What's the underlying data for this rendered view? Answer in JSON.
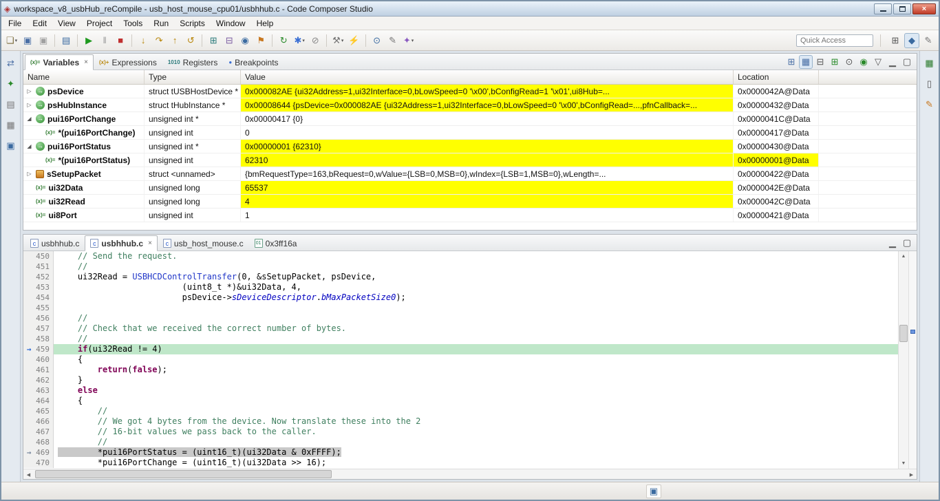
{
  "window": {
    "title": "workspace_v8_usbHub_reCompile - usb_host_mouse_cpu01/usbhhub.c - Code Composer Studio",
    "close_glyph": "×"
  },
  "menubar": {
    "items": [
      "File",
      "Edit",
      "View",
      "Project",
      "Tools",
      "Run",
      "Scripts",
      "Window",
      "Help"
    ]
  },
  "ui": {
    "close": "×",
    "dropdown": "▾",
    "collapsed": "▷",
    "expanded": "◢",
    "var_glyph": "(x)=",
    "ptr_glyph": "→",
    "marker": "→",
    "up": "▲",
    "down": "▼",
    "left": "◀",
    "right": "▶"
  },
  "toolbar": {
    "quick_access": "Quick Access",
    "buttons": [
      {
        "name": "new-file-button",
        "g": "❏",
        "c": "#7a6a3a",
        "dd": true
      },
      {
        "name": "save-button",
        "g": "▣",
        "c": "#4a6fa5"
      },
      {
        "name": "save-all-button",
        "g": "▣",
        "c": "#a0a0a0"
      },
      {
        "sep": true
      },
      {
        "name": "console-button",
        "g": "▤",
        "c": "#3a6aa0"
      },
      {
        "sep": true
      },
      {
        "name": "resume-button",
        "g": "▶",
        "c": "#1f9a1f"
      },
      {
        "name": "suspend-button",
        "g": "‖",
        "c": "#999999"
      },
      {
        "name": "terminate-button",
        "g": "■",
        "c": "#c03030"
      },
      {
        "sep": true
      },
      {
        "name": "step-into-button",
        "g": "↓",
        "c": "#b8860b"
      },
      {
        "name": "step-over-button",
        "g": "↷",
        "c": "#b8860b"
      },
      {
        "name": "step-return-button",
        "g": "↑",
        "c": "#b8860b"
      },
      {
        "name": "reset-cpu-button",
        "g": "↺",
        "c": "#b8860b"
      },
      {
        "sep": true
      },
      {
        "name": "view-registers-button",
        "g": "⊞",
        "c": "#2a7a7a"
      },
      {
        "name": "memory-browser-button",
        "g": "⊟",
        "c": "#7a5aa0"
      },
      {
        "name": "watch-button",
        "g": "◉",
        "c": "#3a6aa0"
      },
      {
        "name": "target-flag-button",
        "g": "⚑",
        "c": "#c87820"
      },
      {
        "sep": true
      },
      {
        "name": "refresh-button",
        "g": "↻",
        "c": "#2a8a2a"
      },
      {
        "name": "breakpoint-button",
        "g": "✱",
        "c": "#3b6fd4",
        "dd": true
      },
      {
        "name": "skip-breakpoints-button",
        "g": "⊘",
        "c": "#888888"
      },
      {
        "sep": true
      },
      {
        "name": "build-button",
        "g": "⚒",
        "c": "#777777",
        "dd": true
      },
      {
        "name": "flash-button",
        "g": "⚡",
        "c": "#c8a000"
      },
      {
        "sep": true
      },
      {
        "name": "search-button",
        "g": "⊙",
        "c": "#3a6aa0"
      },
      {
        "name": "annotate-button",
        "g": "✎",
        "c": "#777777"
      },
      {
        "name": "wand-button",
        "g": "✦",
        "c": "#8a5ac0",
        "dd": true
      }
    ],
    "perspectives": [
      {
        "name": "open-perspective-button",
        "g": "⊞",
        "c": "#555555"
      },
      {
        "name": "ccs-debug-perspective-button",
        "g": "◆",
        "c": "#3a6aa0",
        "pressed": true
      },
      {
        "name": "ccs-edit-perspective-button",
        "g": "✎",
        "c": "#777777"
      }
    ]
  },
  "left_strip": [
    {
      "name": "minimized-view-button-1",
      "g": "⇄",
      "c": "#4a6fa5"
    },
    {
      "name": "minimized-view-button-2",
      "g": "✦",
      "c": "#2a8a2a"
    },
    {
      "name": "minimized-view-button-3",
      "g": "▤",
      "c": "#777777"
    },
    {
      "name": "minimized-view-button-4",
      "g": "▦",
      "c": "#777777"
    },
    {
      "name": "console-view-button",
      "g": "▣",
      "c": "#3a6aa0"
    }
  ],
  "right_strip": [
    {
      "name": "side-grid-button",
      "g": "▦",
      "c": "#2a7a2a"
    },
    {
      "name": "side-device-button",
      "g": "▯",
      "c": "#555555"
    },
    {
      "name": "side-edit-button",
      "g": "✎",
      "c": "#c87820"
    }
  ],
  "variables_view": {
    "tabs": [
      {
        "label": "Variables",
        "icon": "(x)=",
        "icon_color": "#2f7a2f",
        "active": true
      },
      {
        "label": "Expressions",
        "icon": "(x)+",
        "icon_color": "#b8860b"
      },
      {
        "label": "Registers",
        "icon": "1010",
        "icon_color": "#2a7a7a"
      },
      {
        "label": "Breakpoints",
        "icon": "●",
        "icon_color": "#3b6fd4"
      }
    ],
    "toolbar": [
      {
        "name": "show-type-names-button",
        "g": "⊞",
        "c": "#4a6fa5"
      },
      {
        "name": "layout-button",
        "g": "▦",
        "c": "#4a6fa5",
        "pressed": true
      },
      {
        "name": "collapse-all-button",
        "g": "⊟",
        "c": "#555555"
      },
      {
        "name": "new-variables-view-button",
        "g": "⊞",
        "c": "#2a8a2a"
      },
      {
        "name": "pin-view-button",
        "g": "⊙",
        "c": "#555555"
      },
      {
        "name": "continuous-refresh-button",
        "g": "◉",
        "c": "#2a8a2a"
      },
      {
        "name": "view-menu-button",
        "g": "▽",
        "c": "#555555"
      },
      {
        "name": "minimize-view-button",
        "g": "▁",
        "c": "#555555"
      },
      {
        "name": "maximize-view-button",
        "g": "▢",
        "c": "#555555"
      }
    ],
    "columns": [
      "Name",
      "Type",
      "Value",
      "Location"
    ],
    "rows": [
      {
        "name": "psDevice",
        "type": "struct tUSBHostDevice *",
        "value": "0x000082AE {ui32Address=1,ui32Interface=0,bLowSpeed=0 '\\x00',bConfigRead=1 '\\x01',ui8Hub=...",
        "loc": "0x0000042A@Data",
        "vhl": true,
        "exp": "c",
        "icon": "ptr",
        "lvl": 0
      },
      {
        "name": "psHubInstance",
        "type": "struct tHubInstance *",
        "value": "0x00008644 {psDevice=0x000082AE {ui32Address=1,ui32Interface=0,bLowSpeed=0 '\\x00',bConfigRead=...,pfnCallback=...",
        "loc": "0x00000432@Data",
        "vhl": true,
        "exp": "c",
        "icon": "ptr",
        "lvl": 0
      },
      {
        "name": "pui16PortChange",
        "type": "unsigned int *",
        "value": "0x00000417 {0}",
        "loc": "0x0000041C@Data",
        "exp": "e",
        "icon": "ptr",
        "lvl": 0
      },
      {
        "name": "*(pui16PortChange)",
        "type": "unsigned int",
        "value": "0",
        "loc": "0x00000417@Data",
        "icon": "var",
        "lvl": 1
      },
      {
        "name": "pui16PortStatus",
        "type": "unsigned int *",
        "value": "0x00000001 {62310}",
        "loc": "0x00000430@Data",
        "vhl": true,
        "exp": "e",
        "icon": "ptr",
        "lvl": 0
      },
      {
        "name": "*(pui16PortStatus)",
        "type": "unsigned int",
        "value": "62310",
        "loc": "0x00000001@Data",
        "vhl": true,
        "lhl": true,
        "icon": "var",
        "lvl": 1
      },
      {
        "name": "sSetupPacket",
        "type": "struct <unnamed>",
        "value": "{bmRequestType=163,bRequest=0,wValue={LSB=0,MSB=0},wIndex={LSB=1,MSB=0},wLength=...",
        "loc": "0x00000422@Data",
        "exp": "c",
        "icon": "struct",
        "lvl": 0
      },
      {
        "name": "ui32Data",
        "type": "unsigned long",
        "value": "65537",
        "loc": "0x0000042E@Data",
        "vhl": true,
        "icon": "var",
        "lvl": 0
      },
      {
        "name": "ui32Read",
        "type": "unsigned long",
        "value": "4",
        "loc": "0x0000042C@Data",
        "vhl": true,
        "icon": "var",
        "lvl": 0
      },
      {
        "name": "ui8Port",
        "type": "unsigned int",
        "value": "1",
        "loc": "0x00000421@Data",
        "icon": "var",
        "lvl": 0
      }
    ]
  },
  "editor": {
    "tabs": [
      {
        "label": "usbhhub.c",
        "icon": "c"
      },
      {
        "label": "usbhhub.c",
        "icon": "c",
        "active": true
      },
      {
        "label": "usb_host_mouse.c",
        "icon": "c"
      },
      {
        "label": "0x3ff16a",
        "icon": "bin"
      }
    ],
    "toolbar": [
      {
        "name": "minimize-editor-button",
        "g": "▁",
        "c": "#555555"
      },
      {
        "name": "maximize-editor-button",
        "g": "▢",
        "c": "#555555"
      }
    ],
    "lines": [
      {
        "n": 450,
        "s": [
          [
            "p",
            "    "
          ],
          [
            "c",
            "// Send the request."
          ]
        ]
      },
      {
        "n": 451,
        "s": [
          [
            "p",
            "    "
          ],
          [
            "c",
            "//"
          ]
        ]
      },
      {
        "n": 452,
        "s": [
          [
            "p",
            "    ui32Read = "
          ],
          [
            "f",
            "USBHCDControlTransfer"
          ],
          [
            "p",
            "(0, &sSetupPacket, psDevice,"
          ]
        ]
      },
      {
        "n": 453,
        "s": [
          [
            "p",
            "                         (uint8_t *)&ui32Data, 4,"
          ]
        ]
      },
      {
        "n": 454,
        "s": [
          [
            "p",
            "                         psDevice->"
          ],
          [
            "d",
            "sDeviceDescriptor"
          ],
          [
            "p",
            "."
          ],
          [
            "d",
            "bMaxPacketSize0"
          ],
          [
            "p",
            ");"
          ]
        ]
      },
      {
        "n": 455,
        "s": []
      },
      {
        "n": 456,
        "s": [
          [
            "p",
            "    "
          ],
          [
            "c",
            "//"
          ]
        ]
      },
      {
        "n": 457,
        "s": [
          [
            "p",
            "    "
          ],
          [
            "c",
            "// Check that we received the correct number of bytes."
          ]
        ]
      },
      {
        "n": 458,
        "s": [
          [
            "p",
            "    "
          ],
          [
            "c",
            "//"
          ]
        ]
      },
      {
        "n": 459,
        "hl": "current",
        "m": "current",
        "s": [
          [
            "p",
            "    "
          ],
          [
            "k",
            "if"
          ],
          [
            "p",
            "(ui32Read != 4)"
          ]
        ]
      },
      {
        "n": 460,
        "s": [
          [
            "p",
            "    {"
          ]
        ]
      },
      {
        "n": 461,
        "s": [
          [
            "p",
            "        "
          ],
          [
            "k",
            "return"
          ],
          [
            "p",
            "("
          ],
          [
            "k",
            "false"
          ],
          [
            "p",
            ");"
          ]
        ]
      },
      {
        "n": 462,
        "s": [
          [
            "p",
            "    }"
          ]
        ]
      },
      {
        "n": 463,
        "s": [
          [
            "p",
            "    "
          ],
          [
            "k",
            "else"
          ]
        ]
      },
      {
        "n": 464,
        "s": [
          [
            "p",
            "    {"
          ]
        ]
      },
      {
        "n": 465,
        "s": [
          [
            "p",
            "        "
          ],
          [
            "c",
            "//"
          ]
        ]
      },
      {
        "n": 466,
        "s": [
          [
            "p",
            "        "
          ],
          [
            "c",
            "// We got 4 bytes from the device. Now translate these into the 2"
          ]
        ]
      },
      {
        "n": 467,
        "s": [
          [
            "p",
            "        "
          ],
          [
            "c",
            "// 16-bit values we pass back to the caller."
          ]
        ]
      },
      {
        "n": 468,
        "s": [
          [
            "p",
            "        "
          ],
          [
            "c",
            "//"
          ]
        ]
      },
      {
        "n": 469,
        "hl": "secondary",
        "m": "secondary",
        "s": [
          [
            "p",
            "        *pui16PortStatus = (uint16_t)(ui32Data & 0xFFFF);"
          ]
        ]
      },
      {
        "n": 470,
        "s": [
          [
            "p",
            "        *pui16PortChange = (uint16_t)(ui32Data >> 16);"
          ]
        ]
      }
    ]
  }
}
